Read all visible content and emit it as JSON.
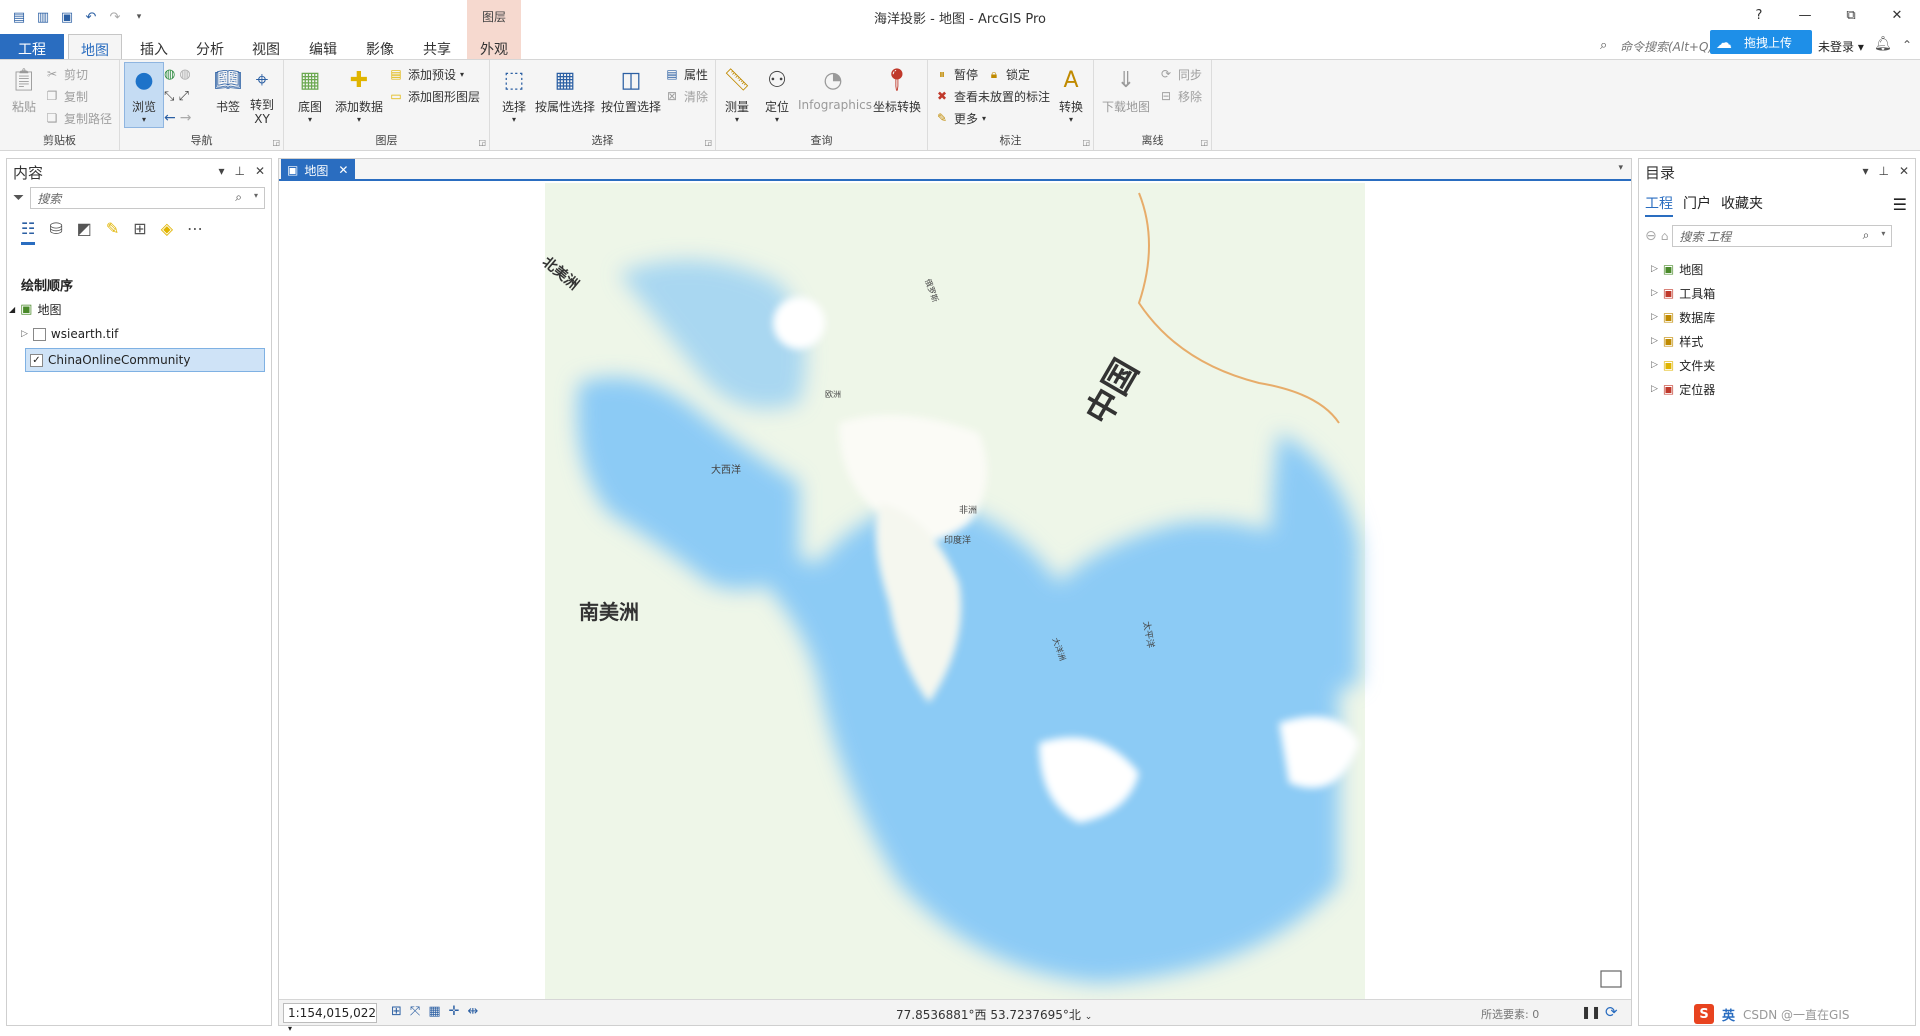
{
  "window": {
    "title": "海洋投影 - 地图 - ArcGIS Pro",
    "context_group": "图层",
    "controls": {
      "help": "?",
      "minimize": "—",
      "restore": "⧉",
      "close": "✕"
    }
  },
  "tabs": [
    "工程",
    "地图",
    "插入",
    "分析",
    "视图",
    "编辑",
    "影像",
    "共享",
    "外观"
  ],
  "command_search": "命令搜索(Alt+Q)",
  "upload_button": "拖拽上传",
  "login": "未登录",
  "ribbon": {
    "clipboard": {
      "label": "剪贴板",
      "paste": "粘贴",
      "cut": "剪切",
      "copy": "复制",
      "copy_path": "复制路径"
    },
    "navigate": {
      "label": "导航",
      "explore": "浏览",
      "bookmarks": "书签",
      "goto_xy": "转到\nXY"
    },
    "layer": {
      "label": "图层",
      "basemap": "底图",
      "add_data": "添加数据",
      "add_preset": "添加预设",
      "add_graphics": "添加图形图层"
    },
    "selection": {
      "label": "选择",
      "select": "选择",
      "by_attr": "按属性选择",
      "by_loc": "按位置选择",
      "attributes": "属性",
      "clear": "清除"
    },
    "inquiry": {
      "label": "查询",
      "measure": "测量",
      "locate": "定位",
      "infographics": "Infographics",
      "coord_conv": "坐标转换"
    },
    "labeling": {
      "label": "标注",
      "pause": "暂停",
      "lock": "锁定",
      "unplaced": "查看未放置的标注",
      "more": "更多",
      "convert": "转换"
    },
    "offline": {
      "label": "离线",
      "download": "下载地图",
      "sync": "同步",
      "remove": "移除"
    }
  },
  "contents": {
    "title": "内容",
    "search_placeholder": "搜索",
    "drawing_order": "绘制顺序",
    "map": "地图",
    "layers": [
      {
        "name": "wsiearth.tif",
        "checked": false
      },
      {
        "name": "ChinaOnlineCommunity",
        "checked": true
      }
    ]
  },
  "map_tab": "地图",
  "map_labels": {
    "atlantic": "大西洋",
    "indian": "印度洋",
    "pacific": "太平洋",
    "south_america": "南美洲",
    "china": "中国",
    "africa": "非洲",
    "europe": "欧洲",
    "australia": "大洋洲",
    "north_america": "北美洲",
    "russia": "俄罗斯"
  },
  "status": {
    "scale": "1:154,015,022",
    "coords": "77.8536881°西 53.7237695°北",
    "selected": "所选要素: 0"
  },
  "catalog": {
    "title": "目录",
    "tabs": [
      "工程",
      "门户",
      "收藏夹"
    ],
    "search_placeholder": "搜索 工程",
    "items": [
      "地图",
      "工具箱",
      "数据库",
      "样式",
      "文件夹",
      "定位器"
    ]
  },
  "ime": {
    "lang": "英",
    "watermark": "CSDN @一直在GIS"
  },
  "colors": {
    "accent": "#2a6dc0",
    "context_tab": "#f6d9cf",
    "ocean": "#8ccbf5",
    "land": "#e7f1d6",
    "upload": "#1e8fe8"
  }
}
